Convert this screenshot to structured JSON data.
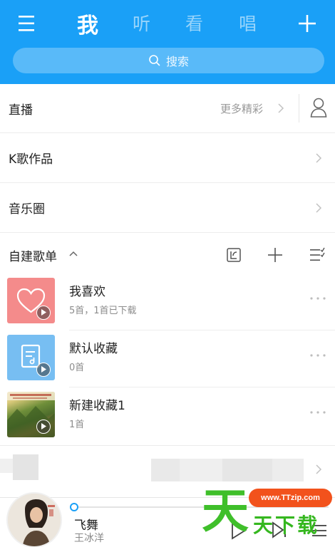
{
  "header": {
    "tabs": [
      {
        "label": "我",
        "active": true
      },
      {
        "label": "听",
        "active": false
      },
      {
        "label": "看",
        "active": false
      },
      {
        "label": "唱",
        "active": false
      }
    ],
    "search_placeholder": "搜索",
    "icons": {
      "menu": "menu-icon",
      "add": "plus-icon",
      "search": "search-icon"
    },
    "accent_color": "#1aa0f7"
  },
  "rows": {
    "live": {
      "label": "直播",
      "more": "更多精彩"
    },
    "karaoke": {
      "label": "K歌作品"
    },
    "music_circle": {
      "label": "音乐圈"
    }
  },
  "playlist_section": {
    "title": "自建歌单",
    "icons": [
      "collapse-caret-icon",
      "import-icon",
      "add-icon",
      "manage-list-icon"
    ]
  },
  "playlists": [
    {
      "name": "我喜欢",
      "sub": "5首，1首已下载",
      "cover": "heart"
    },
    {
      "name": "默认收藏",
      "sub": "0首",
      "cover": "doc"
    },
    {
      "name": "新建收藏1",
      "sub": "1首",
      "cover": "photo"
    }
  ],
  "player": {
    "song": "飞舞",
    "artist": "王冰洋",
    "progress": 0.0
  },
  "watermark": {
    "url": "www.TTzip.com",
    "big": "天",
    "small": "天下载"
  }
}
